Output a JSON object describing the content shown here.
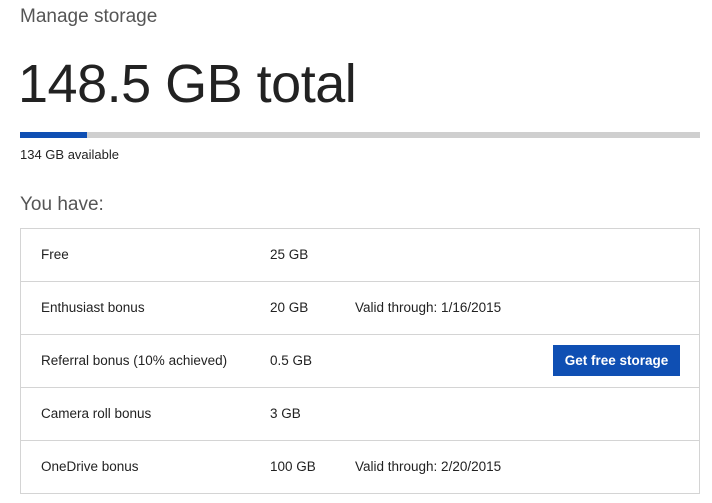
{
  "header": {
    "subtitle": "Manage storage",
    "total": "148.5 GB total"
  },
  "usage": {
    "used_fraction": 0.098,
    "bar_color": "#0f4fb3",
    "track_color": "#cfcfcf",
    "available_text": "134 GB available"
  },
  "plans": {
    "heading": "You have:",
    "rows": [
      {
        "name": "Free",
        "size": "25 GB",
        "valid": "",
        "action": ""
      },
      {
        "name": "Enthusiast bonus",
        "size": "20 GB",
        "valid": "Valid through: 1/16/2015",
        "action": ""
      },
      {
        "name": "Referral bonus (10% achieved)",
        "size": "0.5 GB",
        "valid": "",
        "action": "Get free storage"
      },
      {
        "name": "Camera roll bonus",
        "size": "3 GB",
        "valid": "",
        "action": ""
      },
      {
        "name": "OneDrive bonus",
        "size": "100 GB",
        "valid": "Valid through: 2/20/2015",
        "action": ""
      }
    ]
  }
}
